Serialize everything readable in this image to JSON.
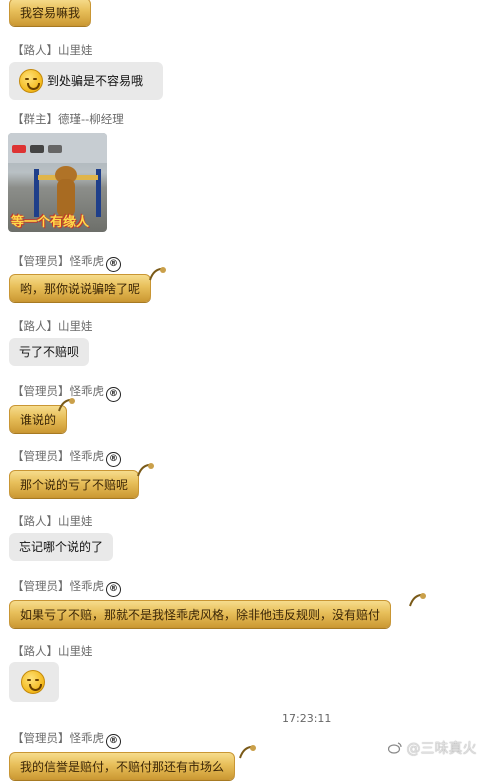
{
  "messages": [
    {
      "text": "我容易嘛我"
    },
    {
      "sender": "【路人】山里娃",
      "text": "到处骗是不容易哦",
      "emoji": "grin-emoji"
    },
    {
      "sender": "【群主】德瑾--柳经理",
      "image_caption": "等一个有缘人"
    },
    {
      "sender": "【管理员】怪乖虎",
      "badge": "®",
      "text": "哟，那你说说骗啥了呢"
    },
    {
      "sender": "【路人】山里娃",
      "text": "亏了不赔呗"
    },
    {
      "sender": "【管理员】怪乖虎",
      "badge": "®",
      "text": "谁说的"
    },
    {
      "sender": "【管理员】怪乖虎",
      "badge": "®",
      "text": "那个说的亏了不赔呢"
    },
    {
      "sender": "【路人】山里娃",
      "text": "忘记哪个说的了"
    },
    {
      "sender": "【管理员】怪乖虎",
      "badge": "®",
      "text": "如果亏了不赔，那就不是我怪乖虎风格，除非他违反规则，没有赔付"
    },
    {
      "sender": "【路人】山里娃",
      "emoji": "grin-emoji"
    },
    {
      "timestamp": "17:23:11"
    },
    {
      "sender": "【管理员】怪乖虎",
      "badge": "®",
      "text": "我的信誉是赔付，不赔付那还有市场么"
    }
  ],
  "watermark": "@三味真火",
  "colors": {
    "gold_bubble": "#e8bf5a",
    "gray_bubble": "#e9e9e9"
  }
}
